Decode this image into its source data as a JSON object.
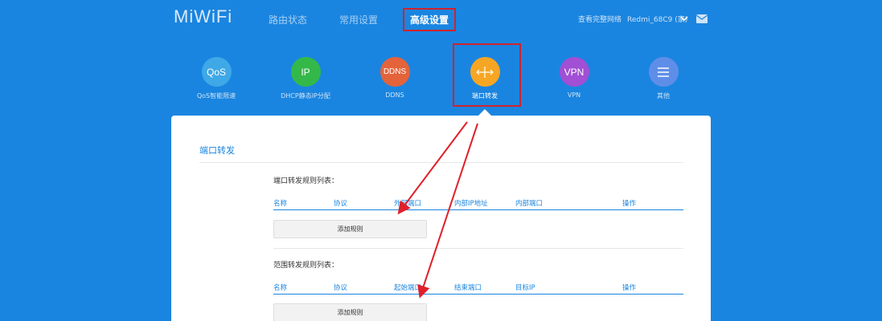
{
  "header": {
    "logo": "MiWiFi",
    "tabs": [
      {
        "label": "路由状态",
        "active": false
      },
      {
        "label": "常用设置",
        "active": false
      },
      {
        "label": "高级设置",
        "active": true
      }
    ],
    "network_link": "查看完整网络",
    "router_name": "Redmi_68C9 (家)"
  },
  "features": [
    {
      "icon": "QoS",
      "label": "QoS智能限速",
      "color": "#3fa8e6"
    },
    {
      "icon": "IP",
      "label": "DHCP静态IP分配",
      "color": "#34b84a"
    },
    {
      "icon": "DDNS",
      "label": "DDNS",
      "color": "#e4633a"
    },
    {
      "icon": "port-forward-icon",
      "label": "端口转发",
      "color": "#f6a623"
    },
    {
      "icon": "VPN",
      "label": "VPN",
      "color": "#a14fd4"
    },
    {
      "icon": "menu-icon",
      "label": "其他",
      "color": "#5f8ee8"
    }
  ],
  "panel": {
    "title": "端口转发",
    "port_rules": {
      "title": "端口转发规则列表：",
      "columns": [
        "名称",
        "协议",
        "外部端口",
        "内部IP地址",
        "内部端口",
        "操作"
      ],
      "add_label": "添加规则"
    },
    "range_rules": {
      "title": "范围转发规则列表：",
      "columns": [
        "名称",
        "协议",
        "起始端口",
        "结束端口",
        "目标IP",
        "操作"
      ],
      "add_label": "添加规则"
    }
  },
  "colors": {
    "background": "#1a85e0",
    "highlight": "#d0232b",
    "accent": "#1a85e0"
  }
}
